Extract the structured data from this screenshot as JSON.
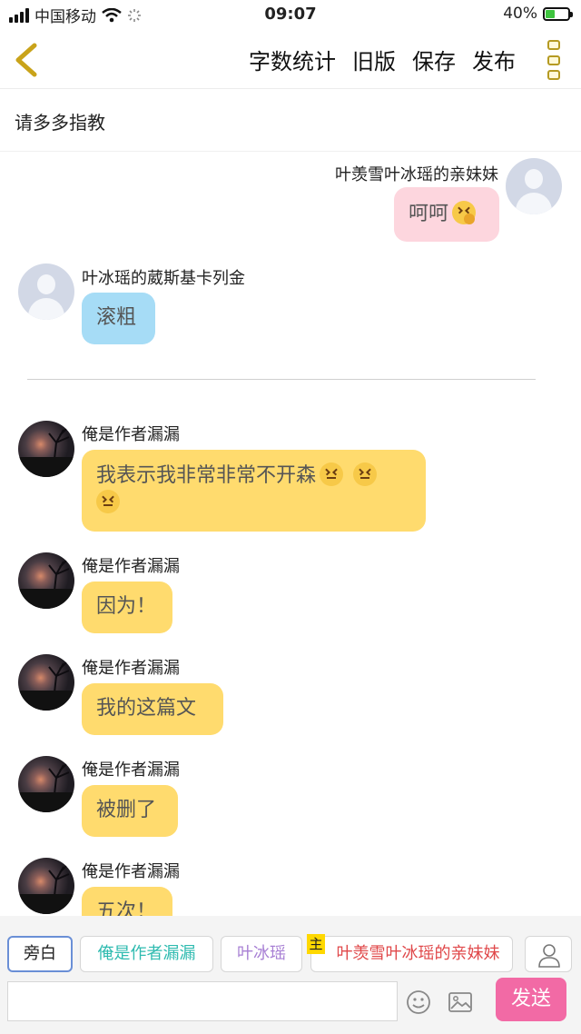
{
  "status_bar": {
    "carrier": "中国移动",
    "time": "09:07",
    "battery": "40%",
    "battery_level": 0.4
  },
  "nav": {
    "actions": [
      "字数统计",
      "旧版",
      "保存",
      "发布"
    ]
  },
  "title": "请多多指教",
  "messages": [
    {
      "side": "right",
      "name": "叶羡雪叶冰瑶的亲妹妹",
      "text": "呵呵",
      "bubble": "pink",
      "avatar": "default",
      "emoji": "face-with-hand-over-mouth"
    },
    {
      "side": "left",
      "name": "叶冰瑶的葳斯基卡列金",
      "text": "滚粗",
      "bubble": "blue",
      "avatar": "default"
    },
    {
      "side": "left",
      "name": "俺是作者漏漏",
      "text": "我表示我非常非常不开森",
      "bubble": "yellow",
      "avatar": "photo",
      "emoji": "confounded-face",
      "emoji_count": 3
    },
    {
      "side": "left",
      "name": "俺是作者漏漏",
      "text": "因为！",
      "bubble": "yellow",
      "avatar": "photo"
    },
    {
      "side": "left",
      "name": "俺是作者漏漏",
      "text": "我的这篇文",
      "bubble": "yellow",
      "avatar": "photo"
    },
    {
      "side": "left",
      "name": "俺是作者漏漏",
      "text": "被删了",
      "bubble": "yellow",
      "avatar": "photo"
    },
    {
      "side": "left",
      "name": "俺是作者漏漏",
      "text": "五次！",
      "bubble": "yellow",
      "avatar": "photo"
    }
  ],
  "cast": {
    "narration": "旁白",
    "characters": [
      "俺是作者漏漏",
      "叶冰瑶",
      "叶羡雪叶冰瑶的亲妹妹"
    ],
    "host_tag": "主"
  },
  "input": {
    "placeholder": "",
    "send_label": "发送"
  },
  "colors": {
    "accent_yellow": "#ffdb6e",
    "pink_bubble": "#fdd6de",
    "blue_bubble": "#a6dcf6",
    "send_button": "#f26aa5"
  }
}
